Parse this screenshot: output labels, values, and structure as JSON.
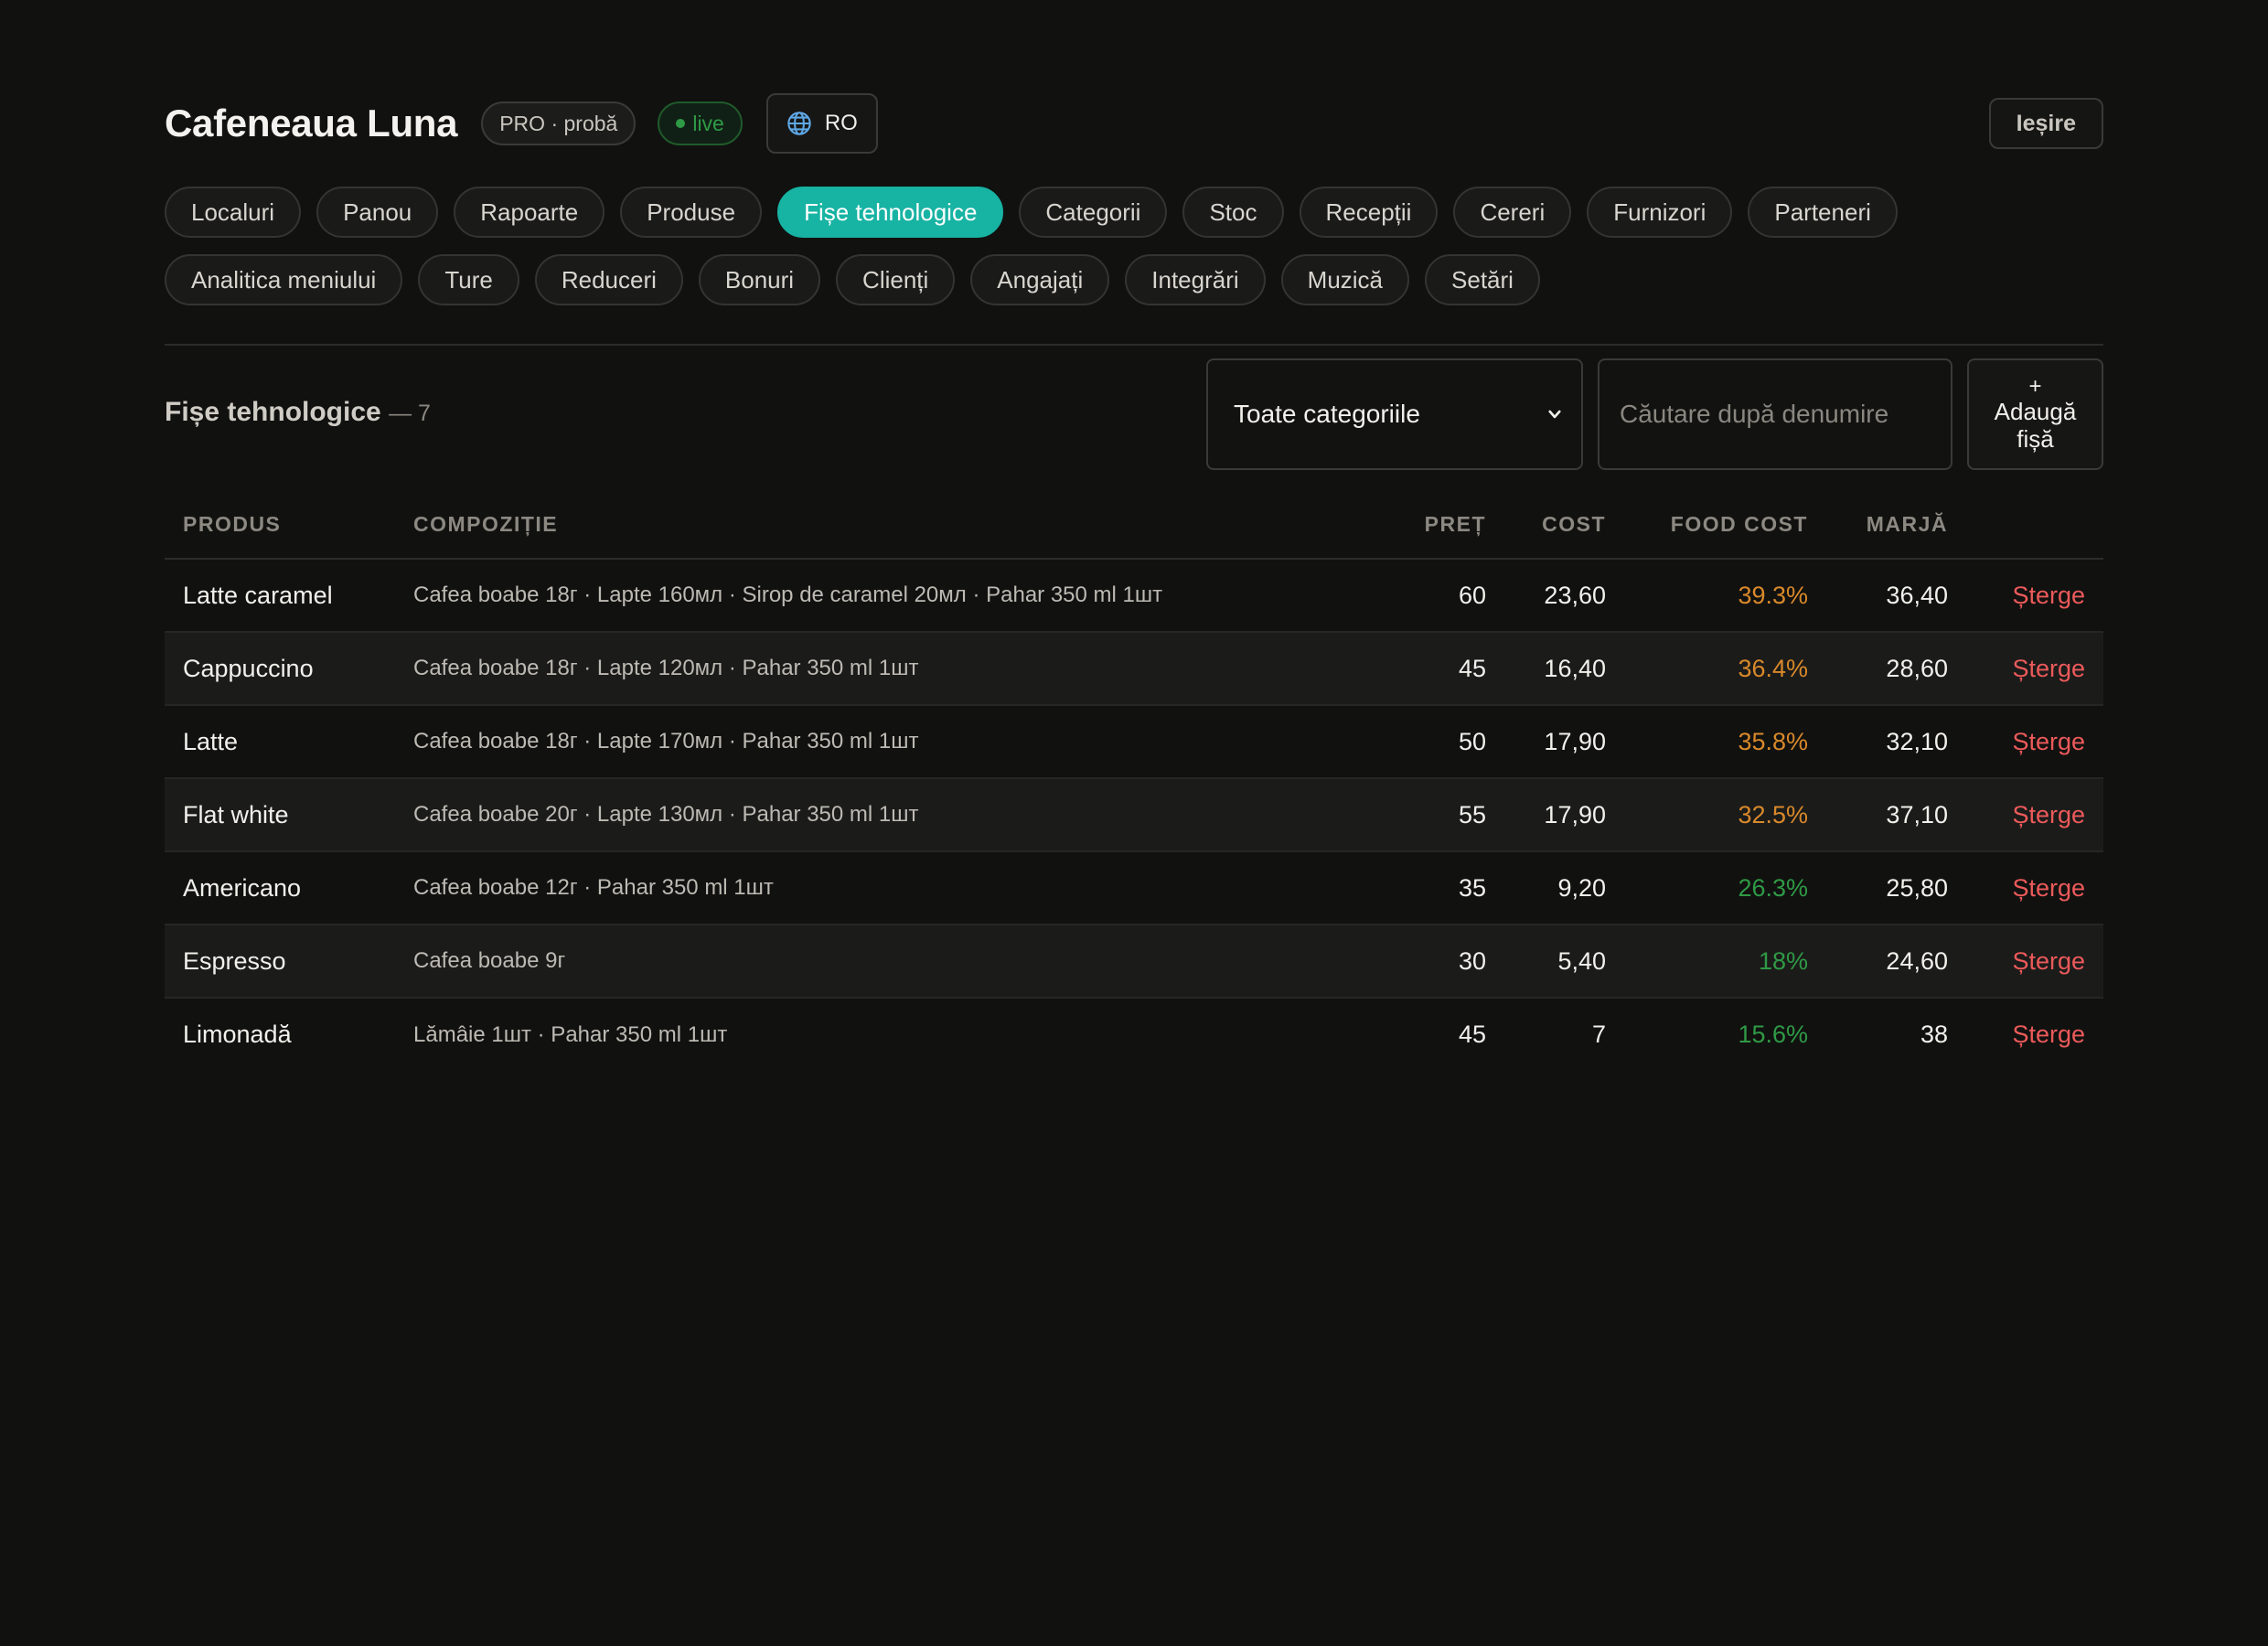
{
  "header": {
    "title": "Cafeneaua Luna",
    "plan_badge": "PRO · probă",
    "live_badge": "live",
    "language": "RO",
    "exit_label": "Ieșire"
  },
  "nav": {
    "items": [
      {
        "label": "Localuri",
        "active": false
      },
      {
        "label": "Panou",
        "active": false
      },
      {
        "label": "Rapoarte",
        "active": false
      },
      {
        "label": "Produse",
        "active": false
      },
      {
        "label": "Fișe tehnologice",
        "active": true
      },
      {
        "label": "Categorii",
        "active": false
      },
      {
        "label": "Stoc",
        "active": false
      },
      {
        "label": "Recepții",
        "active": false
      },
      {
        "label": "Cereri",
        "active": false
      },
      {
        "label": "Furnizori",
        "active": false
      },
      {
        "label": "Parteneri",
        "active": false
      },
      {
        "label": "Analitica meniului",
        "active": false
      },
      {
        "label": "Ture",
        "active": false
      },
      {
        "label": "Reduceri",
        "active": false
      },
      {
        "label": "Bonuri",
        "active": false
      },
      {
        "label": "Clienți",
        "active": false
      },
      {
        "label": "Angajați",
        "active": false
      },
      {
        "label": "Integrări",
        "active": false
      },
      {
        "label": "Muzică",
        "active": false
      },
      {
        "label": "Setări",
        "active": false
      }
    ]
  },
  "toolbar": {
    "section_title": "Fișe tehnologice",
    "count": "— 7",
    "category_select": "Toate categoriile",
    "search_placeholder": "Căutare după denumire",
    "add_plus": "+",
    "add_line1": "Adaugă",
    "add_line2": "fișă"
  },
  "table": {
    "columns": {
      "product": "PRODUS",
      "composition": "COMPOZIȚIE",
      "price": "PREȚ",
      "cost": "COST",
      "food_cost": "FOOD COST",
      "margin": "MARJĂ"
    },
    "delete_label": "Șterge",
    "rows": [
      {
        "product": "Latte caramel",
        "composition": "Cafea boabe 18г · Lapte 160мл · Sirop de caramel 20мл · Pahar 350 ml 1шт",
        "price": "60",
        "cost": "23,60",
        "food_cost": "39.3%",
        "margin": "36,40",
        "fc_level": "orange"
      },
      {
        "product": "Cappuccino",
        "composition": "Cafea boabe 18г · Lapte 120мл · Pahar 350 ml 1шт",
        "price": "45",
        "cost": "16,40",
        "food_cost": "36.4%",
        "margin": "28,60",
        "fc_level": "orange"
      },
      {
        "product": "Latte",
        "composition": "Cafea boabe 18г · Lapte 170мл · Pahar 350 ml 1шт",
        "price": "50",
        "cost": "17,90",
        "food_cost": "35.8%",
        "margin": "32,10",
        "fc_level": "orange"
      },
      {
        "product": "Flat white",
        "composition": "Cafea boabe 20г · Lapte 130мл · Pahar 350 ml 1шт",
        "price": "55",
        "cost": "17,90",
        "food_cost": "32.5%",
        "margin": "37,10",
        "fc_level": "orange"
      },
      {
        "product": "Americano",
        "composition": "Cafea boabe 12г · Pahar 350 ml 1шт",
        "price": "35",
        "cost": "9,20",
        "food_cost": "26.3%",
        "margin": "25,80",
        "fc_level": "green"
      },
      {
        "product": "Espresso",
        "composition": "Cafea boabe 9г",
        "price": "30",
        "cost": "5,40",
        "food_cost": "18%",
        "margin": "24,60",
        "fc_level": "green"
      },
      {
        "product": "Limonadă",
        "composition": "Lămâie 1шт · Pahar 350 ml 1шт",
        "price": "45",
        "cost": "7",
        "food_cost": "15.6%",
        "margin": "38",
        "fc_level": "green"
      }
    ]
  },
  "colors": {
    "accent": "#17b3a3",
    "live": "#2f9a45",
    "food_cost_orange": "#d9892a",
    "food_cost_green": "#2f9a45",
    "delete": "#ec5a5a"
  }
}
